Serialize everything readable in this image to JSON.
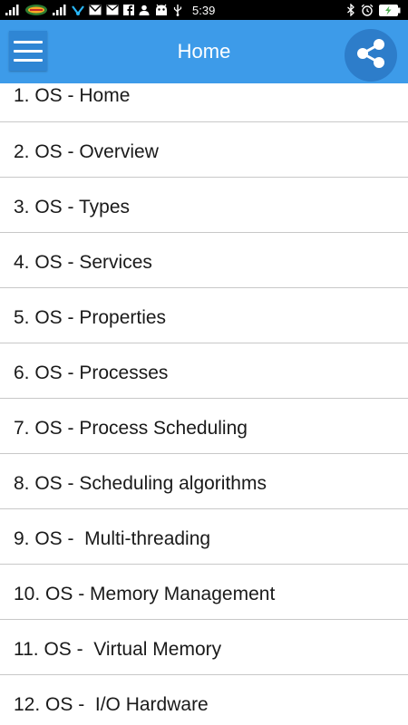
{
  "status_bar": {
    "time": "5:39",
    "icons": [
      "signal-icon",
      "carrier-logo-icon",
      "signal-icon",
      "network-icon",
      "gmail-icon",
      "mail-icon",
      "facebook-icon",
      "person-icon",
      "android-icon",
      "usb-icon",
      "bluetooth-icon",
      "alarm-icon",
      "battery-icon"
    ]
  },
  "app_bar": {
    "title": "Home",
    "menu_icon": "hamburger-menu-icon",
    "share_icon": "share-icon",
    "color": "#3d9be9"
  },
  "list": {
    "items": [
      {
        "label": "1. OS - Home"
      },
      {
        "label": "2. OS - Overview"
      },
      {
        "label": "3. OS - Types"
      },
      {
        "label": "4. OS - Services"
      },
      {
        "label": "5. OS - Properties"
      },
      {
        "label": "6. OS - Processes"
      },
      {
        "label": "7. OS - Process Scheduling"
      },
      {
        "label": "8. OS - Scheduling algorithms"
      },
      {
        "label": "9. OS -  Multi-threading"
      },
      {
        "label": "10. OS - Memory Management"
      },
      {
        "label": "11. OS -  Virtual Memory"
      },
      {
        "label": "12. OS -  I/O Hardware"
      }
    ]
  }
}
